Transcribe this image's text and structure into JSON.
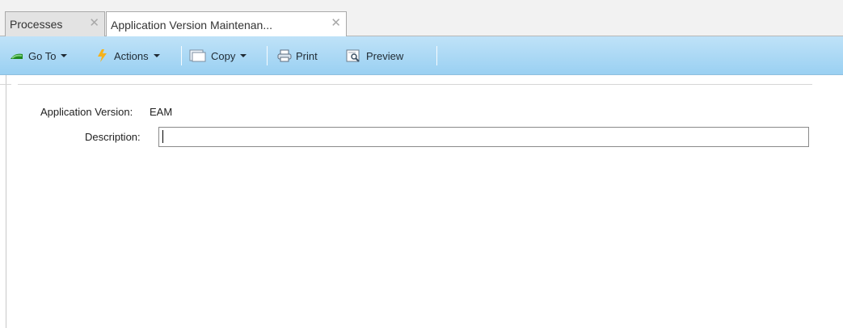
{
  "tabs": [
    {
      "label": "Processes",
      "close_glyph": "✕",
      "active": false
    },
    {
      "label": "Application Version Maintenan...",
      "close_glyph": "✕",
      "active": true
    }
  ],
  "toolbar": {
    "goto_label": "Go To",
    "actions_label": "Actions",
    "copy_label": "Copy",
    "print_label": "Print",
    "preview_label": "Preview",
    "goto_icon": "go-to-arrow-icon",
    "actions_icon": "lightning-icon",
    "copy_icon": "copy-icon",
    "print_icon": "printer-icon",
    "preview_icon": "preview-icon",
    "bar_color": "#a9d7f5"
  },
  "form": {
    "app_version_label": "Application Version:",
    "app_version_value": "EAM",
    "description_label": "Description:",
    "description_value": ""
  }
}
